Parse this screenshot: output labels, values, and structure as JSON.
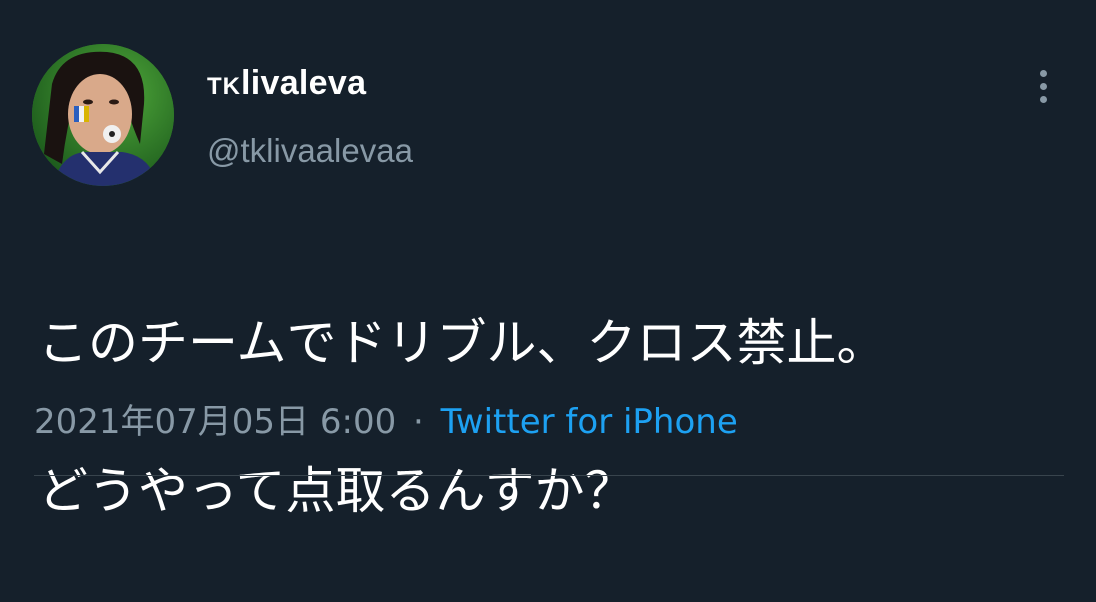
{
  "tweet": {
    "display_name_prefix": "TK",
    "display_name_main": "livaleva",
    "handle": "@tklivaalevaa",
    "text_line1": "このチームでドリブル、クロス禁止。",
    "text_line2": "どうやって点取るんすか？",
    "timestamp": "2021年07月05日 6:00",
    "separator": "·",
    "source": "Twitter for iPhone"
  },
  "icons": {
    "more": "more-vertical-icon",
    "avatar": "avatar-image"
  },
  "colors": {
    "background": "#15202b",
    "text_primary": "#ffffff",
    "text_secondary": "#8899a6",
    "link": "#1da1f2",
    "divider": "#38444d"
  }
}
